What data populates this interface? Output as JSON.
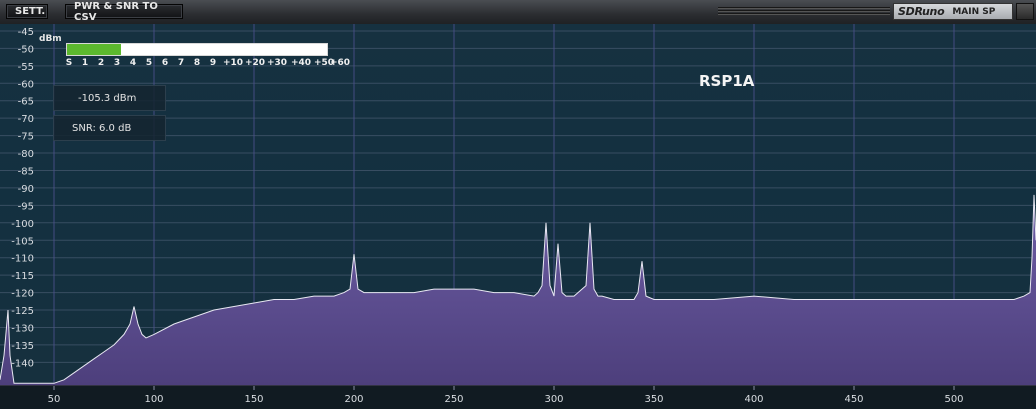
{
  "toolbar": {
    "settings_label": "SETT.",
    "export_label": "PWR & SNR TO CSV"
  },
  "brand": {
    "logo": "SDRuno",
    "window_name": "MAIN SP"
  },
  "meter": {
    "unit_label": "dBm",
    "scale_labels": [
      "S",
      "1",
      "2",
      "3",
      "4",
      "5",
      "6",
      "7",
      "8",
      "9",
      "+10",
      "+20",
      "+30",
      "+40",
      "+50",
      "+60"
    ],
    "fill_fraction": 0.207,
    "fill_color": "#5cb82e"
  },
  "readouts": {
    "power": "-105.3 dBm",
    "snr": "SNR: 6.0 dB"
  },
  "device_name": "RSP1A",
  "chart_data": {
    "type": "area",
    "y_ticks": [
      "-45",
      "-50",
      "-55",
      "-60",
      "-65",
      "-70",
      "-75",
      "-80",
      "-85",
      "-90",
      "-95",
      "-100",
      "-105",
      "-110",
      "-115",
      "-120",
      "-125",
      "-130",
      "-135",
      "-140"
    ],
    "x_ticks": [
      "50",
      "100",
      "150",
      "200",
      "250",
      "300",
      "350",
      "400",
      "450",
      "500"
    ],
    "xlim": [
      23,
      541
    ],
    "ylim": [
      -146.5,
      -43
    ],
    "grid": true,
    "fill_color": "#5b4d8c",
    "line_color": "#e8e8f2",
    "x": [
      23,
      25,
      27,
      28,
      30,
      34,
      40,
      45,
      50,
      55,
      60,
      65,
      70,
      75,
      80,
      85,
      88,
      90,
      92,
      94,
      96,
      100,
      110,
      120,
      130,
      140,
      150,
      160,
      170,
      180,
      190,
      195,
      198,
      200,
      202,
      205,
      210,
      220,
      230,
      240,
      250,
      260,
      270,
      280,
      290,
      292,
      294,
      296,
      298,
      300,
      302,
      304,
      306,
      310,
      312,
      314,
      316,
      318,
      320,
      322,
      324,
      330,
      340,
      342,
      344,
      346,
      350,
      360,
      380,
      400,
      420,
      440,
      460,
      480,
      500,
      520,
      530,
      535,
      538,
      539,
      540,
      541
    ],
    "y": [
      -145,
      -138,
      -125,
      -138,
      -146,
      -146,
      -146,
      -146,
      -146,
      -145,
      -143,
      -141,
      -139,
      -137,
      -135,
      -132,
      -129,
      -124,
      -129,
      -132,
      -133,
      -132,
      -129,
      -127,
      -125,
      -124,
      -123,
      -122,
      -122,
      -121,
      -121,
      -120,
      -119,
      -109,
      -119,
      -120,
      -120,
      -120,
      -120,
      -119,
      -119,
      -119,
      -120,
      -120,
      -121,
      -120,
      -118,
      -100,
      -118,
      -121,
      -106,
      -120,
      -121,
      -121,
      -120,
      -119,
      -118,
      -100,
      -119,
      -121,
      -121,
      -122,
      -122,
      -120,
      -111,
      -121,
      -122,
      -122,
      -122,
      -121,
      -122,
      -122,
      -122,
      -122,
      -122,
      -122,
      -122,
      -121,
      -120,
      -110,
      -92,
      -105
    ]
  }
}
